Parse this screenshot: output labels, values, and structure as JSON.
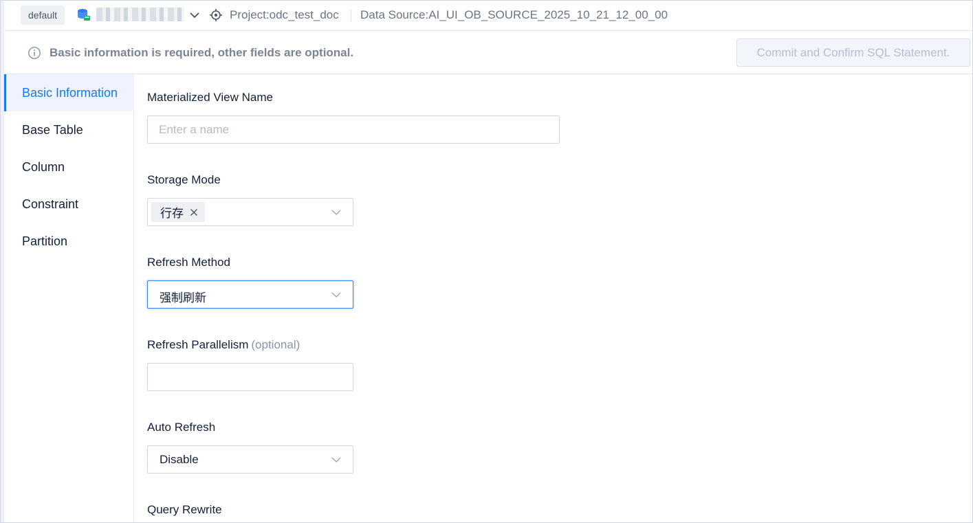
{
  "topbar": {
    "env_tag": "default",
    "project": "Project:odc_test_doc",
    "data_source": "Data Source:AI_UI_OB_SOURCE_2025_10_21_12_00_00"
  },
  "infobar": {
    "message": "Basic information is required, other fields are optional.",
    "commit_button": "Commit and Confirm SQL Statement."
  },
  "sidebar": {
    "items": [
      {
        "label": "Basic Information",
        "active": true
      },
      {
        "label": "Base Table"
      },
      {
        "label": "Column"
      },
      {
        "label": "Constraint"
      },
      {
        "label": "Partition"
      }
    ]
  },
  "form": {
    "mv_name": {
      "label": "Materialized View Name",
      "placeholder": "Enter a name",
      "value": ""
    },
    "storage_mode": {
      "label": "Storage Mode",
      "selected_tag": "行存"
    },
    "refresh_method": {
      "label": "Refresh Method",
      "value": "强制刷新"
    },
    "refresh_parallelism": {
      "label": "Refresh Parallelism",
      "optional": "(optional)",
      "value": ""
    },
    "auto_refresh": {
      "label": "Auto Refresh",
      "value": "Disable"
    },
    "query_rewrite": {
      "label": "Query Rewrite"
    }
  },
  "colors": {
    "accent": "#1677ff",
    "active_bg": "#eef3fd",
    "muted_text": "#6b7585"
  }
}
